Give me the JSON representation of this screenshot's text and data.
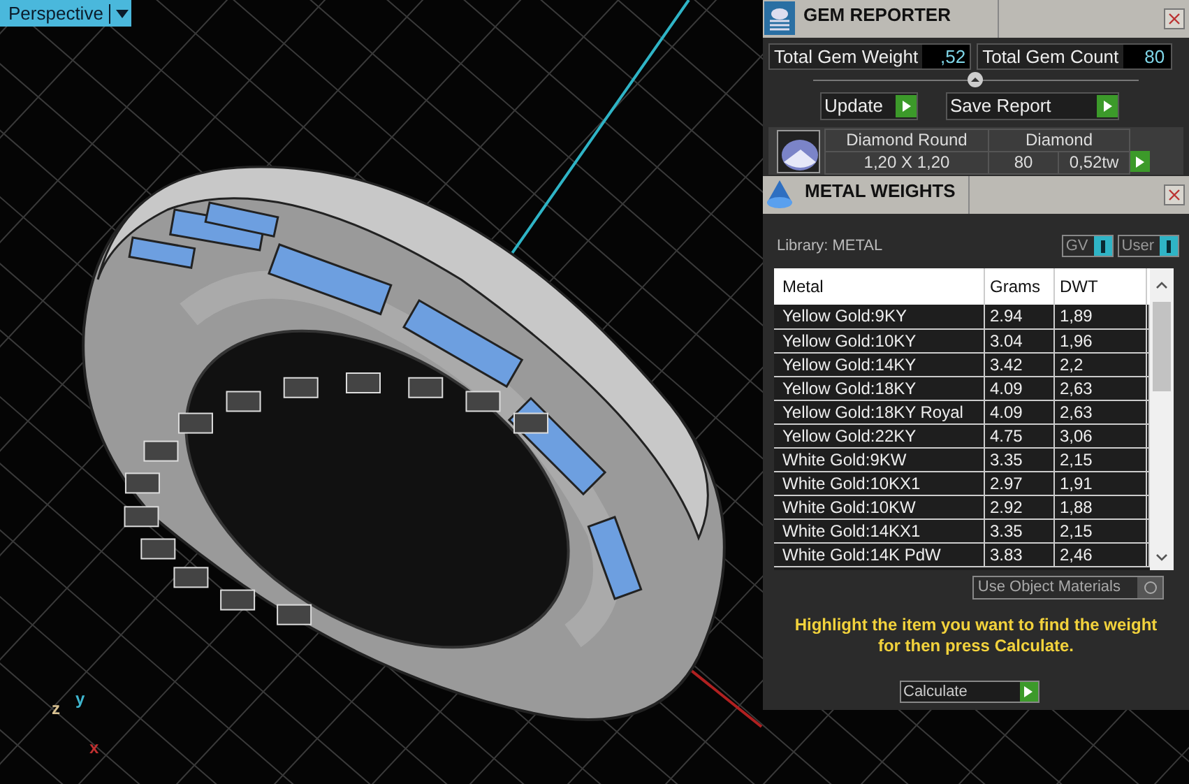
{
  "viewport": {
    "view_menu": "Perspective",
    "axes": [
      {
        "label": "x",
        "kind": "x"
      },
      {
        "label": "y",
        "kind": "y"
      },
      {
        "label": "z",
        "kind": "z"
      }
    ]
  },
  "gem_reporter": {
    "title": "GEM REPORTER",
    "total_gem_weight_label": "Total Gem Weight",
    "total_gem_weight": ",52",
    "total_gem_count_label": "Total Gem Count",
    "total_gem_count": "80",
    "buttons": [
      "Update",
      "Save Report"
    ],
    "gem": {
      "shape": "Diamond Round",
      "size": "1,20 X 1,20",
      "material": "Diamond",
      "count": "80",
      "weight": "0,52tw"
    }
  },
  "metal_weights": {
    "title": "METAL WEIGHTS",
    "library": "Library: METAL",
    "toggles": [
      {
        "label": "GV",
        "on": true
      },
      {
        "label": "User",
        "on": true
      }
    ],
    "columns": [
      "Metal",
      "Grams",
      "DWT"
    ],
    "rows": [
      [
        "Yellow Gold:9KY",
        "2.94",
        "1,89"
      ],
      [
        "Yellow Gold:10KY",
        "3.04",
        "1,96"
      ],
      [
        "Yellow Gold:14KY",
        "3.42",
        "2,2"
      ],
      [
        "Yellow Gold:18KY",
        "4.09",
        "2,63"
      ],
      [
        "Yellow Gold:18KY Royal",
        "4.09",
        "2,63"
      ],
      [
        "Yellow Gold:22KY",
        "4.75",
        "3,06"
      ],
      [
        "White Gold:9KW",
        "3.35",
        "2,15"
      ],
      [
        "White Gold:10KX1",
        "2.97",
        "1,91"
      ],
      [
        "White Gold:10KW",
        "2.92",
        "1,88"
      ],
      [
        "White Gold:14KX1",
        "3.35",
        "2,15"
      ],
      [
        "White Gold:14K PdW",
        "3.83",
        "2,46"
      ]
    ],
    "use_object_materials": {
      "label": "Use Object Materials",
      "on": false
    },
    "hint": "Highlight the item you want to find the weight for then press Calculate.",
    "button": "Calculate"
  }
}
